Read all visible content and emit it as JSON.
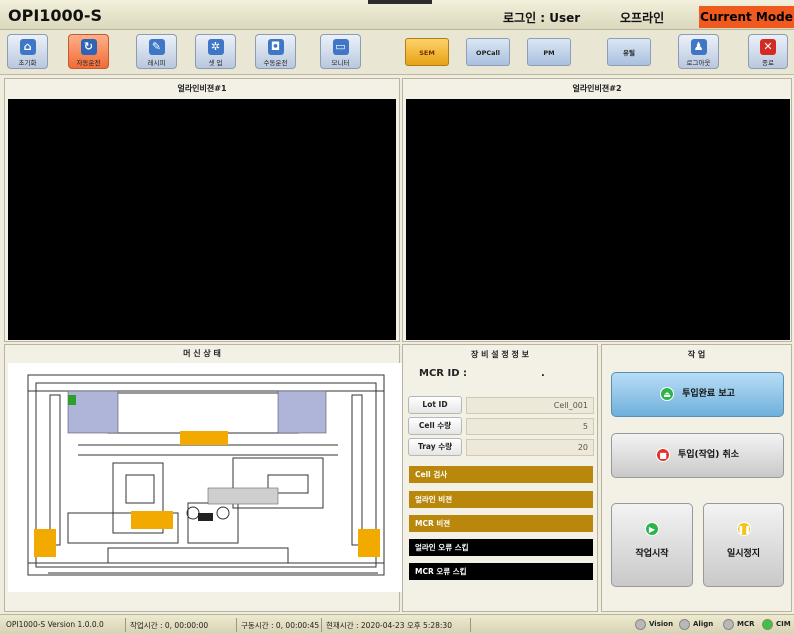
{
  "header": {
    "title": "OPI1000-S",
    "login": "로그인 : User",
    "status": "오프라인",
    "mode": "Current Mode"
  },
  "toolbar": {
    "buttons": [
      {
        "label": "초기화",
        "icon": "home-icon"
      },
      {
        "label": "자동운전",
        "icon": "auto-run-icon"
      },
      {
        "label": "레시피",
        "icon": "recipe-icon"
      },
      {
        "label": "셋 업",
        "icon": "gear-icon"
      },
      {
        "label": "수동운전",
        "icon": "gamepad-icon"
      },
      {
        "label": "모니터",
        "icon": "monitor-icon"
      }
    ],
    "modes": [
      "SEM",
      "OPCall",
      "PM"
    ],
    "right": [
      {
        "label": "유틸"
      },
      {
        "label": "로그아웃",
        "icon": "user-icon"
      },
      {
        "label": "종료",
        "icon": "close-icon"
      }
    ]
  },
  "vision1": {
    "title": "얼라인비젼#1"
  },
  "vision2": {
    "title": "얼라인비젼#2"
  },
  "machine": {
    "title": "머 신 상 태"
  },
  "settings": {
    "title": "장 비 설 정 정 보",
    "mcr_label": "MCR ID :",
    "mcr_value": ".",
    "rows": [
      {
        "label": "Lot ID",
        "value": "Cell_001"
      },
      {
        "label": "Cell 수량",
        "value": "5"
      },
      {
        "label": "Tray 수량",
        "value": "20"
      }
    ],
    "bars": [
      {
        "label": "Cell 검사",
        "state": "gold"
      },
      {
        "label": "얼라인 비젼",
        "state": "gold"
      },
      {
        "label": "MCR 비젼",
        "state": "gold"
      },
      {
        "label": "얼라인 오류 스킵",
        "state": "black"
      },
      {
        "label": "MCR 오류 스킵",
        "state": "black"
      }
    ]
  },
  "work": {
    "title": "작 업",
    "report": "투입완료 보고",
    "cancel": "투입(작업) 취소",
    "start": "작업시작",
    "pause": "일시정지"
  },
  "statusbar": {
    "version": "OPI1000-S  Version 1.0.0.0",
    "work_time": "작업시간 : 0, 00:00:00",
    "run_time": "구동시간 : 0, 00:00:45",
    "current_time": "현재시간 : 2020-04-23 오후 5:28:30",
    "indicators": [
      {
        "label": "Vision",
        "color": "#b8b8b8"
      },
      {
        "label": "Align",
        "color": "#b8b8b8"
      },
      {
        "label": "MCR",
        "color": "#b8b8b8"
      },
      {
        "label": "CIM",
        "color": "#3cc43c"
      }
    ]
  }
}
